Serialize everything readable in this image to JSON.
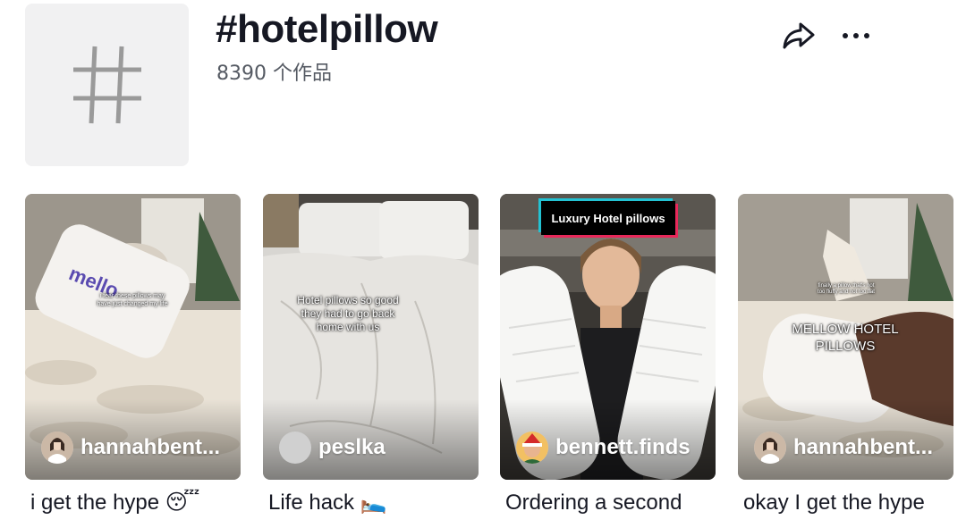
{
  "header": {
    "title": "#hotelpillow",
    "count": "8390 个作品"
  },
  "videos": [
    {
      "author": "hannahbent...",
      "caption": "i get the hype 😴",
      "overlay": "i fear these pillows may have just changed my life",
      "product_text": "mello"
    },
    {
      "author": "peslka",
      "caption": "Life hack 🛌",
      "overlay": "Hotel pillows so good they had to go back home with us"
    },
    {
      "author": "bennett.finds",
      "caption": "Ordering a second",
      "badge": "Luxury Hotel pillows"
    },
    {
      "author": "hannahbent...",
      "caption": "okay I get the hype",
      "overlay_small": "finally a pillow that's not too fluffy and not too flat",
      "overlay_big": "MELLOW HOTEL PILLOWS"
    }
  ],
  "colors": {
    "text": "#161823",
    "secondary": "#555a63",
    "tag_bg": "#f1f1f2"
  }
}
